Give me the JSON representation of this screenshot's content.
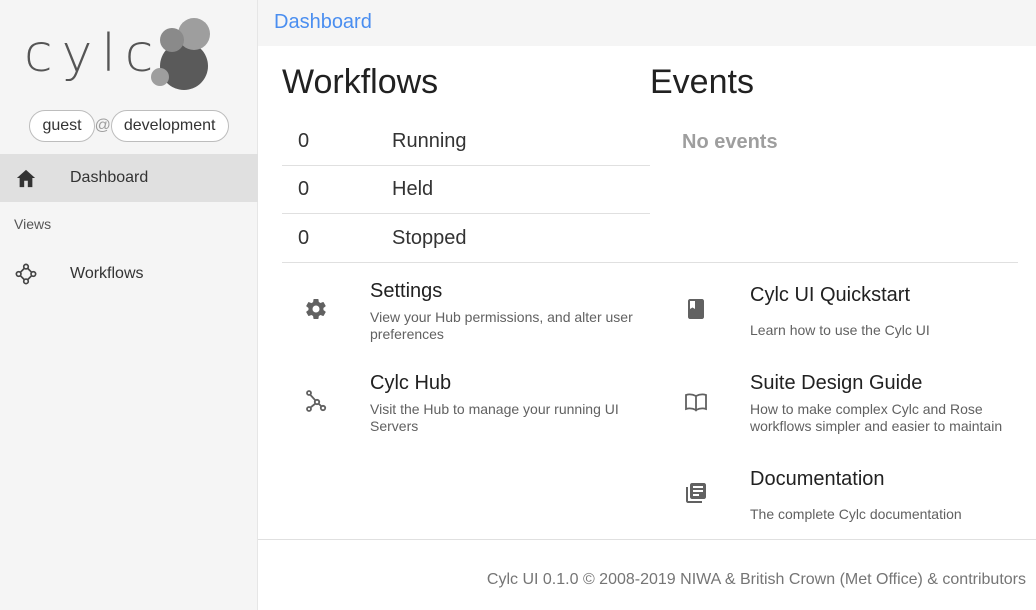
{
  "app": {
    "logo_text": "cylc"
  },
  "user": {
    "name": "guest",
    "separator": "@",
    "server": "development"
  },
  "sidebar": {
    "items": [
      {
        "label": "Dashboard",
        "icon": "home-icon",
        "active": true
      },
      {
        "label": "Workflows",
        "icon": "workflow-graph-icon",
        "active": false
      }
    ],
    "section_label": "Views"
  },
  "topbar": {
    "title": "Dashboard"
  },
  "workflows": {
    "title": "Workflows",
    "rows": [
      {
        "count": "0",
        "state": "Running"
      },
      {
        "count": "0",
        "state": "Held"
      },
      {
        "count": "0",
        "state": "Stopped"
      }
    ]
  },
  "events": {
    "title": "Events",
    "empty_text": "No events"
  },
  "links": {
    "settings": {
      "title": "Settings",
      "desc": "View your Hub permissions, and alter user preferences",
      "icon": "gear-icon"
    },
    "hub": {
      "title": "Cylc Hub",
      "desc": "Visit the Hub to manage your running UI Servers",
      "icon": "hub-icon"
    },
    "quickstart": {
      "title": "Cylc UI Quickstart",
      "desc": "Learn how to use the Cylc UI",
      "icon": "book-icon"
    },
    "design_guide": {
      "title": "Suite Design Guide",
      "desc": "How to make complex Cylc and Rose workflows simpler and easier to maintain",
      "icon": "open-book-icon"
    },
    "documentation": {
      "title": "Documentation",
      "desc": "The complete Cylc documentation",
      "icon": "library-books-icon"
    }
  },
  "footer": {
    "text": "Cylc UI 0.1.0 © 2008-2019 NIWA & British Crown (Met Office) & contributors"
  },
  "colors": {
    "accent": "#4a8ef0",
    "sidebar_bg": "#f5f5f5",
    "active_bg": "#e0e0e0"
  }
}
